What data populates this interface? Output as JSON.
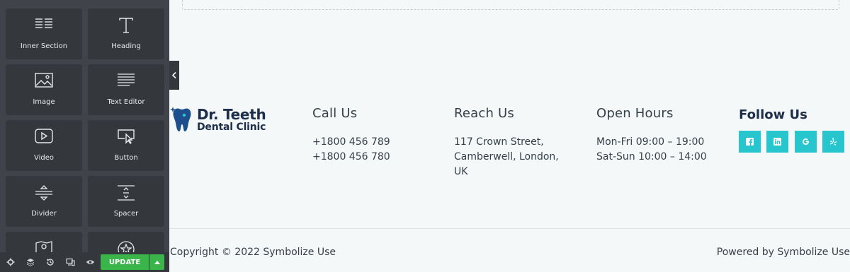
{
  "panel": {
    "widgets": [
      {
        "label": "Inner Section",
        "icon": "inner-section-icon"
      },
      {
        "label": "Heading",
        "icon": "heading-icon"
      },
      {
        "label": "Image",
        "icon": "image-icon"
      },
      {
        "label": "Text Editor",
        "icon": "text-editor-icon"
      },
      {
        "label": "Video",
        "icon": "video-icon"
      },
      {
        "label": "Button",
        "icon": "button-icon"
      },
      {
        "label": "Divider",
        "icon": "divider-icon"
      },
      {
        "label": "Spacer",
        "icon": "spacer-icon"
      },
      {
        "label": "",
        "icon": "google-maps-icon"
      },
      {
        "label": "",
        "icon": "icon-widget-icon"
      }
    ],
    "footer": {
      "update_label": "UPDATE",
      "icons": [
        "settings-icon",
        "navigator-layers-icon",
        "history-icon",
        "responsive-mode-icon",
        "preview-eye-icon"
      ]
    },
    "accent": "#39b54a"
  },
  "site": {
    "logo": {
      "line1": "Dr. Teeth",
      "line2": "Dental Clinic"
    },
    "call": {
      "title": "Call Us",
      "phone1": "+1800 456 789",
      "phone2": "+1800 456 780"
    },
    "reach": {
      "title": "Reach Us",
      "line1": "117 Crown Street,",
      "line2": "Camberwell, London,",
      "line3": "UK"
    },
    "hours": {
      "title": "Open Hours",
      "line1": "Mon-Fri 09:00 – 19:00",
      "line2": "Sat-Sun 10:00 – 14:00"
    },
    "follow": {
      "title": "Follow Us",
      "icons": [
        "facebook-icon",
        "linkedin-icon",
        "google-icon",
        "yelp-icon"
      ],
      "color": "#27c6cf"
    },
    "copyright": "Copyright © 2022 Symbolize Use",
    "powered": "Powered by Symbolize Use"
  }
}
